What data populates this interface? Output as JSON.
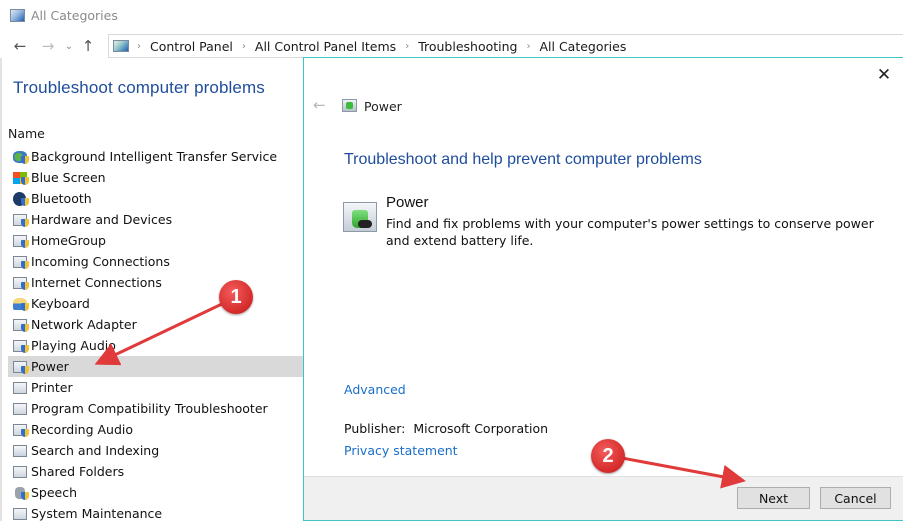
{
  "window": {
    "title": "All Categories"
  },
  "navigation": {
    "back_icon": "arrow-left-icon",
    "forward_icon": "arrow-right-icon",
    "recent_icon": "chevron-down-icon",
    "up_icon": "arrow-up-icon",
    "back_glyph": "←",
    "forward_glyph": "→",
    "recent_glyph": "⌄",
    "up_glyph": "↑",
    "separator_glyph": "›",
    "breadcrumbs": [
      "Control Panel",
      "All Control Panel Items",
      "Troubleshooting",
      "All Categories"
    ]
  },
  "left_pane": {
    "title": "Troubleshoot computer problems",
    "column_header": "Name",
    "items": [
      {
        "label": "Background Intelligent Transfer Service",
        "icon": "bits-icon"
      },
      {
        "label": "Blue Screen",
        "icon": "windows-logo-icon"
      },
      {
        "label": "Bluetooth",
        "icon": "bluetooth-icon"
      },
      {
        "label": "Hardware and Devices",
        "icon": "hardware-icon"
      },
      {
        "label": "HomeGroup",
        "icon": "homegroup-icon"
      },
      {
        "label": "Incoming Connections",
        "icon": "incoming-connections-icon"
      },
      {
        "label": "Internet Connections",
        "icon": "internet-connections-icon"
      },
      {
        "label": "Keyboard",
        "icon": "keyboard-icon"
      },
      {
        "label": "Network Adapter",
        "icon": "network-adapter-icon"
      },
      {
        "label": "Playing Audio",
        "icon": "audio-icon"
      },
      {
        "label": "Power",
        "icon": "power-icon",
        "selected": true
      },
      {
        "label": "Printer",
        "icon": "printer-icon"
      },
      {
        "label": "Program Compatibility Troubleshooter",
        "icon": "program-compatibility-icon"
      },
      {
        "label": "Recording Audio",
        "icon": "recording-audio-icon"
      },
      {
        "label": "Search and Indexing",
        "icon": "search-indexing-icon"
      },
      {
        "label": "Shared Folders",
        "icon": "shared-folders-icon"
      },
      {
        "label": "Speech",
        "icon": "speech-icon"
      },
      {
        "label": "System Maintenance",
        "icon": "system-maintenance-icon"
      }
    ]
  },
  "dialog": {
    "close_glyph": "✕",
    "back_glyph": "←",
    "header_title": "Power",
    "heading": "Troubleshoot and help prevent computer problems",
    "troubleshooter_name": "Power",
    "troubleshooter_description": "Find and fix problems with your computer's power settings to conserve power and extend battery life.",
    "advanced_link": "Advanced",
    "publisher_label": "Publisher:",
    "publisher_value": "Microsoft Corporation",
    "privacy_link": "Privacy statement",
    "next_button": "Next",
    "cancel_button": "Cancel"
  },
  "annotations": {
    "step_1": "1",
    "step_2": "2",
    "color": "#e03a3a"
  }
}
